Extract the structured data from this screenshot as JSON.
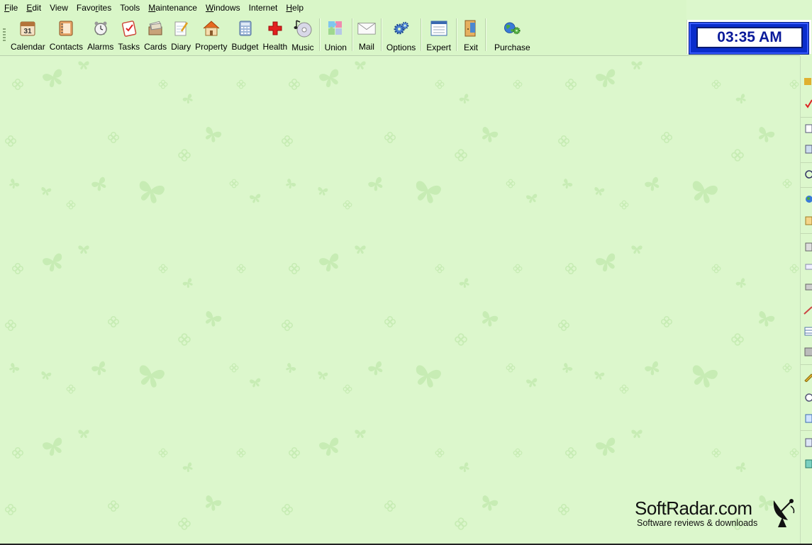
{
  "menu": [
    {
      "label": "File",
      "acc": "F",
      "rest": "ile"
    },
    {
      "label": "Edit",
      "acc": "E",
      "rest": "dit"
    },
    {
      "label": "View",
      "acc": "",
      "rest": "View"
    },
    {
      "label": "Favorites",
      "pre": "Favo",
      "acc": "r",
      "rest": "ites"
    },
    {
      "label": "Tools",
      "acc": "",
      "rest": "Tools"
    },
    {
      "label": "Maintenance",
      "acc": "M",
      "rest": "aintenance"
    },
    {
      "label": "Windows",
      "acc": "W",
      "rest": "indows"
    },
    {
      "label": "Internet",
      "acc": "",
      "rest": "Internet"
    },
    {
      "label": "Help",
      "acc": "H",
      "rest": "elp"
    }
  ],
  "toolbar": {
    "calendar": "Calendar",
    "calendar_icon_text": "31",
    "contacts": "Contacts",
    "alarms": "Alarms",
    "tasks": "Tasks",
    "cards": "Cards",
    "diary": "Diary",
    "property": "Property",
    "budget": "Budget",
    "health": "Health",
    "music": "Music",
    "union": "Union",
    "mail": "Mail",
    "options": "Options",
    "expert": "Expert",
    "exit": "Exit",
    "purchase": "Purchase"
  },
  "clock": {
    "time": "03:35 AM"
  },
  "watermark": {
    "title": "SoftRadar.com",
    "subtitle": "Software reviews & downloads"
  },
  "colors": {
    "background": "#dcf7cc",
    "toolbar": "#d9f6c8",
    "clock_blue": "#0a2dcc",
    "pattern": "#c6ebb3"
  }
}
